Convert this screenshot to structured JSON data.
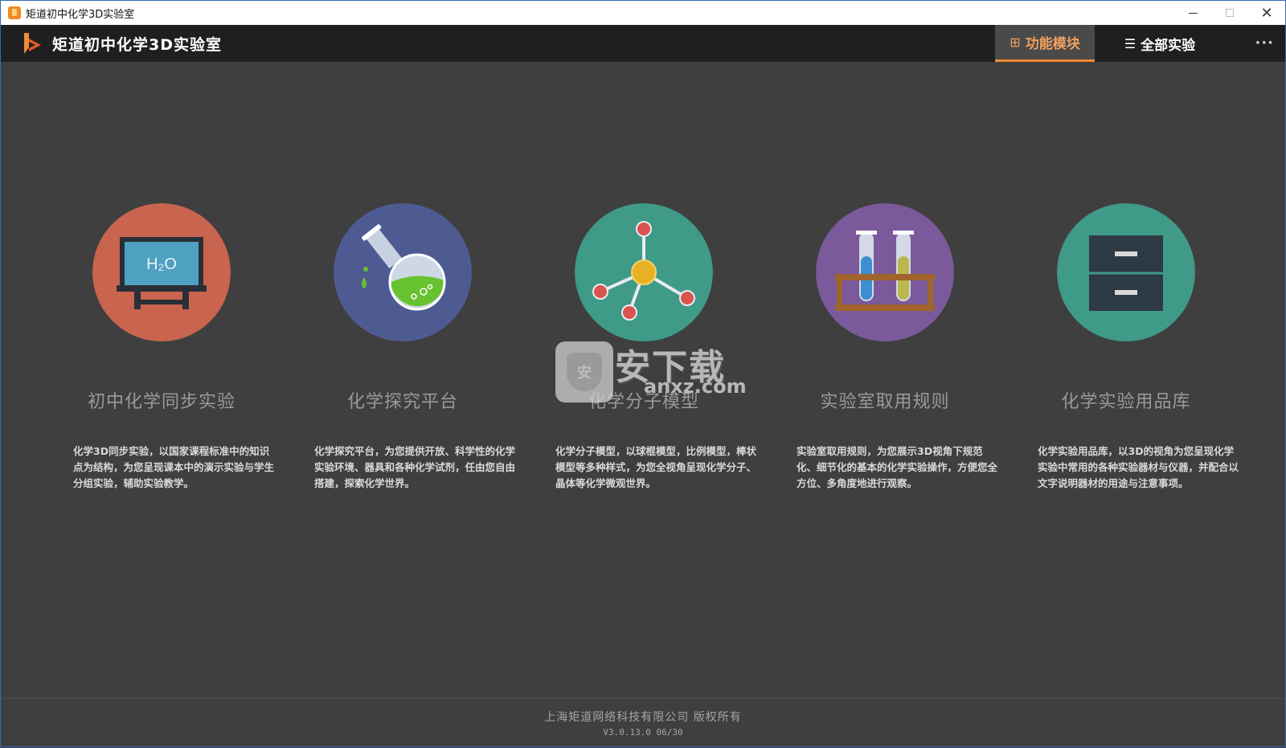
{
  "window": {
    "title": "矩道初中化学3D实验室"
  },
  "app": {
    "title": "矩道初中化学3D实验室",
    "accent_color": "#f08a34"
  },
  "nav": {
    "tabs": [
      {
        "label": "功能模块",
        "icon": "grid-icon",
        "active": true
      },
      {
        "label": "全部实验",
        "icon": "list-icon",
        "active": false
      }
    ],
    "more_label": "···"
  },
  "modules": [
    {
      "name": "初中化学同步实验",
      "icon": "blackboard-h2o-icon",
      "icon_text": "H₂O",
      "color": "#c9654e",
      "description": "化学3D同步实验，以国家课程标准中的知识点为结构，为您呈现课本中的演示实验与学生分组实验，辅助实验教学。"
    },
    {
      "name": "化学探究平台",
      "icon": "flask-icon",
      "color": "#4e5b93",
      "description": "化学探究平台，为您提供开放、科学性的化学实验环境、器具和各种化学试剂，任由您自由搭建，探索化学世界。"
    },
    {
      "name": "化学分子模型",
      "icon": "molecule-icon",
      "color": "#3f9a88",
      "description": "化学分子模型，以球棍模型，比例模型，棒状模型等多种样式，为您全视角呈现化学分子、晶体等化学微观世界。"
    },
    {
      "name": "实验室取用规则",
      "icon": "test-tubes-icon",
      "color": "#7a5a9a",
      "description": "实验室取用规则，为您展示3D视角下规范化、细节化的基本的化学实验操作，方便您全方位、多角度地进行观察。"
    },
    {
      "name": "化学实验用品库",
      "icon": "cabinet-icon",
      "color": "#3f9a88",
      "description": "化学实验用品库，以3D的视角为您呈现化学实验中常用的各种实验器材与仪器，并配合以文字说明器材的用途与注意事项。"
    }
  ],
  "watermark": {
    "text": "安下载",
    "url": "anxz.com",
    "badge": "安"
  },
  "footer": {
    "copyright": "上海矩道网络科技有限公司 版权所有",
    "version": "V3.0.13.0 06/30"
  }
}
